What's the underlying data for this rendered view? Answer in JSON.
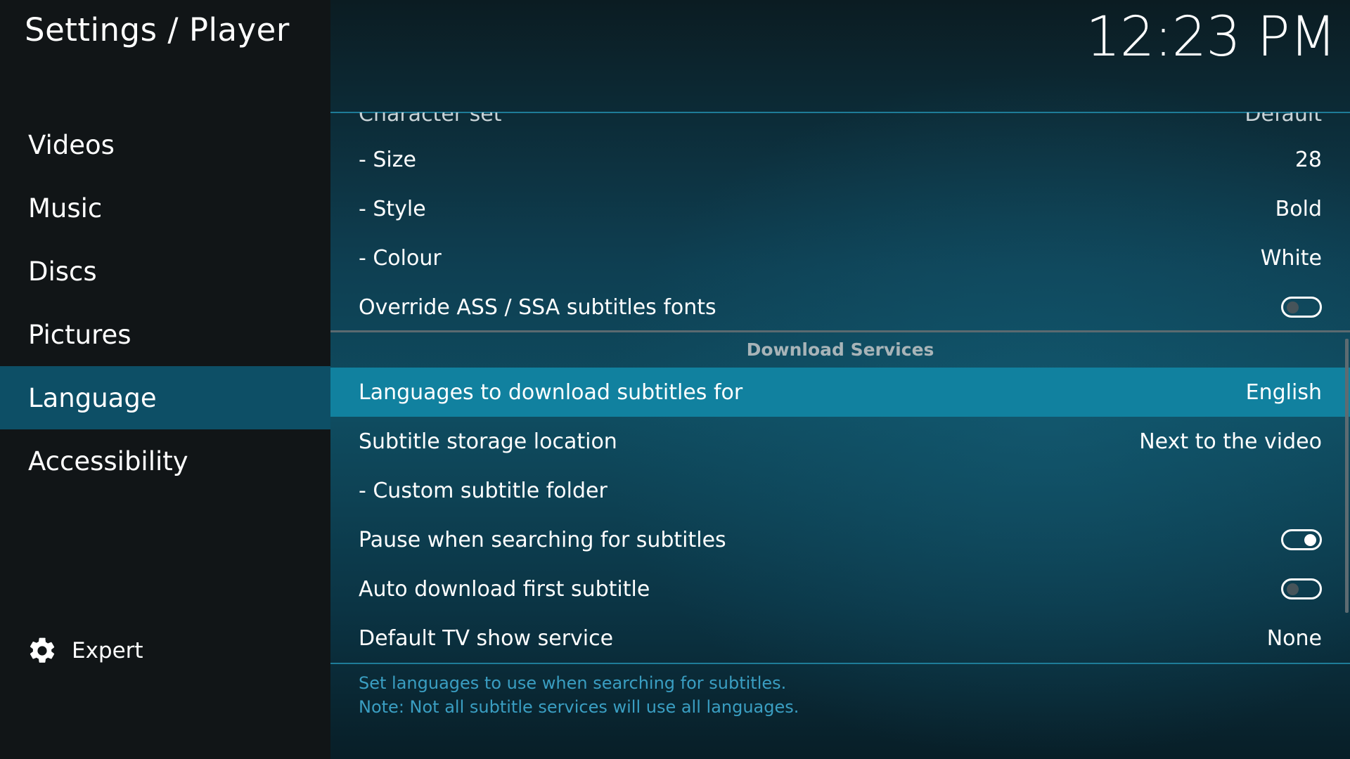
{
  "header": {
    "title": "Settings / Player",
    "clock": "12:23 PM"
  },
  "sidebar": {
    "items": [
      {
        "label": "Videos",
        "active": false
      },
      {
        "label": "Music",
        "active": false
      },
      {
        "label": "Discs",
        "active": false
      },
      {
        "label": "Pictures",
        "active": false
      },
      {
        "label": "Language",
        "active": true
      },
      {
        "label": "Accessibility",
        "active": false
      }
    ],
    "expert": {
      "label": "Expert",
      "icon": "gear-icon"
    }
  },
  "settings": {
    "cut_row": {
      "label": "Character set",
      "value": "Default"
    },
    "rows_top": [
      {
        "label": "- Size",
        "value": "28",
        "type": "value"
      },
      {
        "label": "- Style",
        "value": "Bold",
        "type": "value"
      },
      {
        "label": "- Colour",
        "value": "White",
        "type": "value"
      },
      {
        "label": "Override ASS / SSA subtitles fonts",
        "type": "toggle",
        "enabled": false
      }
    ],
    "section_title": "Download Services",
    "rows_bottom": [
      {
        "label": "Languages to download subtitles for",
        "value": "English",
        "type": "value",
        "selected": true
      },
      {
        "label": "Subtitle storage location",
        "value": "Next to the video",
        "type": "value"
      },
      {
        "label": "- Custom subtitle folder",
        "value": "",
        "type": "value"
      },
      {
        "label": "Pause when searching for subtitles",
        "type": "toggle",
        "enabled": true
      },
      {
        "label": "Auto download first subtitle",
        "type": "toggle",
        "enabled": false
      },
      {
        "label": "Default TV show service",
        "value": "None",
        "type": "value"
      }
    ]
  },
  "help": {
    "line1": "Set languages to use when searching for subtitles.",
    "line2": "Note: Not all subtitle services will use all languages."
  },
  "colors": {
    "accent": "#11819f",
    "sidebar_active": "#0d4f66",
    "help_text": "#3a9ec2"
  }
}
